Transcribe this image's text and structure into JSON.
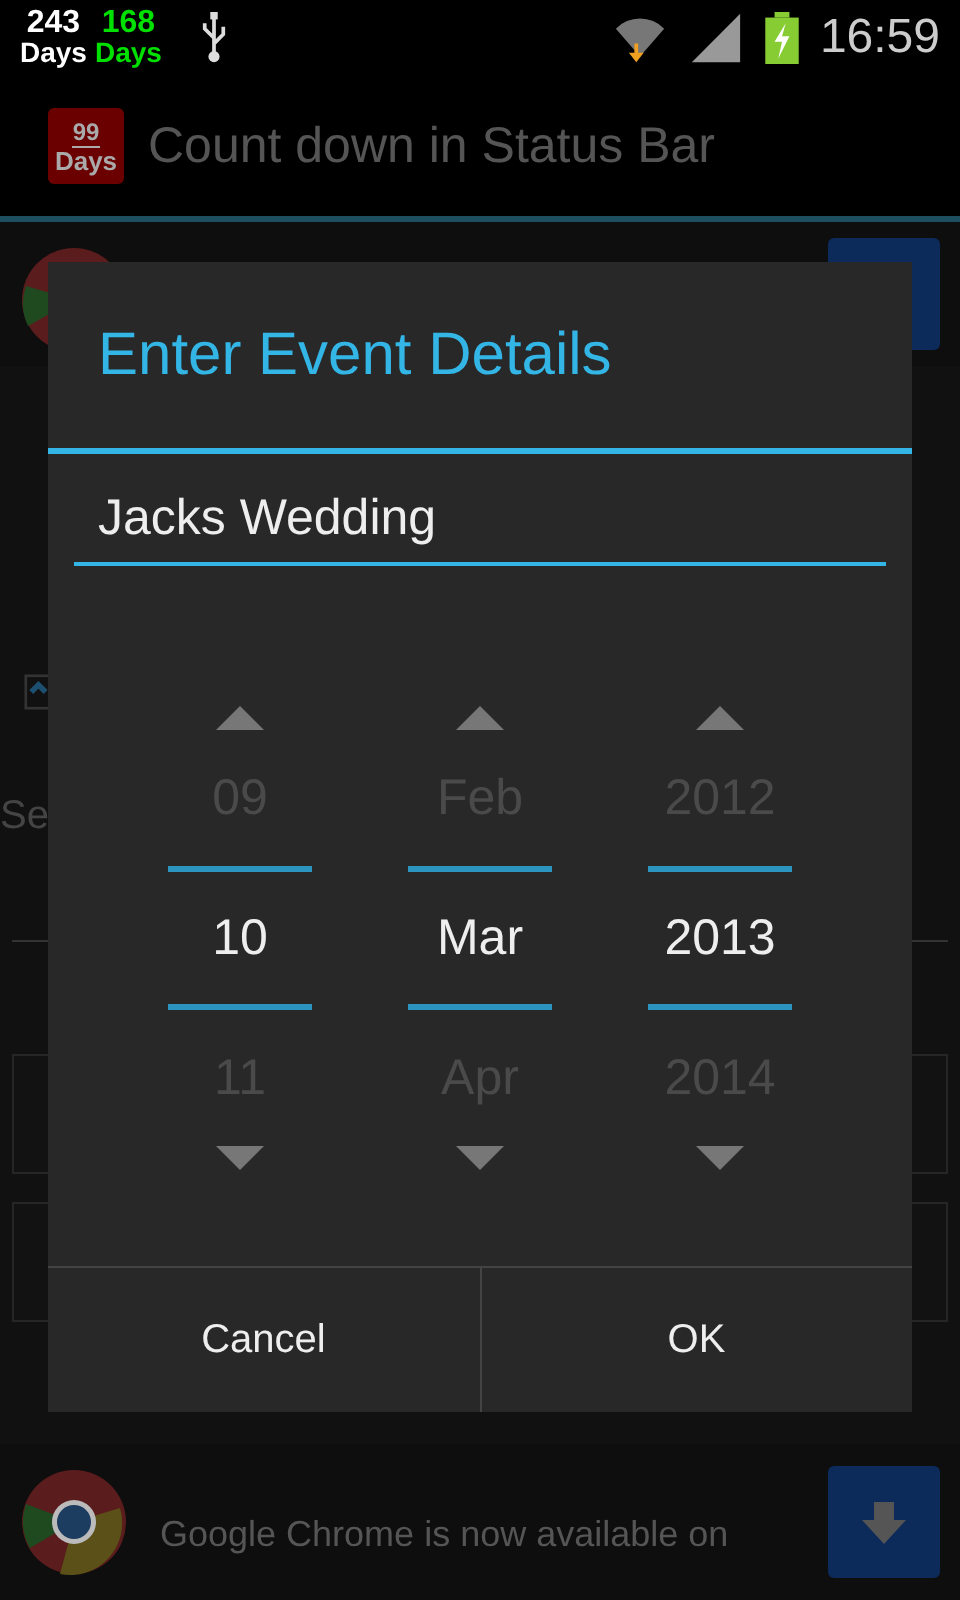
{
  "status_bar": {
    "counters": [
      {
        "number": "243",
        "unit": "Days",
        "color": "#ffffff"
      },
      {
        "number": "168",
        "unit": "Days",
        "color": "#00e000"
      }
    ],
    "time": "16:59"
  },
  "app_bar": {
    "icon_number": "99",
    "icon_unit": "Days",
    "title": "Count down in Status Bar"
  },
  "background": {
    "checkbox_checked": true,
    "label": "Se",
    "banner_text": "Google Chrome is now available on"
  },
  "dialog": {
    "title": "Enter Event Details",
    "input_value": "Jacks Wedding",
    "pickers": [
      {
        "previous": "09",
        "current": "10",
        "next": "11"
      },
      {
        "previous": "Feb",
        "current": "Mar",
        "next": "Apr"
      },
      {
        "previous": "2012",
        "current": "2013",
        "next": "2014"
      }
    ],
    "buttons": [
      "Cancel",
      "OK"
    ]
  }
}
